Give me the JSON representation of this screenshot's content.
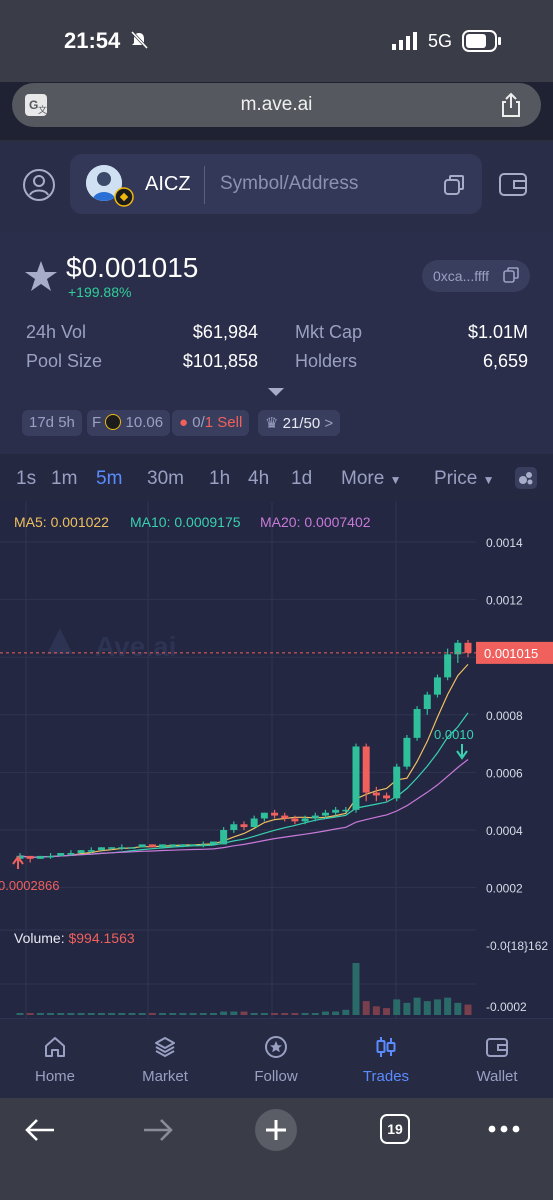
{
  "status_bar": {
    "time": "21:54",
    "network": "5G"
  },
  "browser": {
    "url": "m.ave.ai",
    "tabs_count": "19"
  },
  "header": {
    "token_symbol": "AICZ",
    "search_placeholder": "Symbol/Address"
  },
  "token": {
    "price": "$0.001015",
    "change": "+199.88%",
    "address": "0xca...ffff"
  },
  "stats": {
    "vol_label": "24h Vol",
    "vol_value": "$61,984",
    "pool_label": "Pool Size",
    "pool_value": "$101,858",
    "mcap_label": "Mkt Cap",
    "mcap_value": "$1.01M",
    "holders_label": "Holders",
    "holders_value": "6,659"
  },
  "chips": {
    "age": "17d 5h",
    "f_prefix": "F",
    "f_value": "10.06",
    "sell_zero": "0/",
    "sell_label": "1 Sell",
    "holders_ratio": "21/50",
    "chevron": ">"
  },
  "timeframes": [
    "1s",
    "1m",
    "5m",
    "30m",
    "1h",
    "4h",
    "1d"
  ],
  "active_timeframe": "5m",
  "more_label": "More",
  "price_label": "Price",
  "chart_data": {
    "type": "candlestick",
    "ma": {
      "ma5_label": "MA5: 0.001022",
      "ma10_label": "MA10: 0.0009175",
      "ma20_label": "MA20: 0.0007402"
    },
    "y_ticks": [
      "0.0014",
      "0.0012",
      "0.0010",
      "0.0008",
      "0.0006",
      "0.0004",
      "0.0002",
      "-0.0{18}162",
      "-0.0002"
    ],
    "current_price_label": "0.001015",
    "high_marker": "0.0010",
    "low_marker": "0.0002866",
    "watermark": "Ave.ai",
    "volume_label": "Volume:",
    "volume_value": "$994.1563",
    "ylim": [
      0.00015,
      0.0014
    ],
    "candles": [
      [
        0.0003,
        0.00031,
        0.00032,
        0.00029
      ],
      [
        0.00031,
        0.0003,
        0.00031,
        0.000287
      ],
      [
        0.0003,
        0.00031,
        0.00031,
        0.0003
      ],
      [
        0.00031,
        0.00031,
        0.00032,
        0.0003
      ],
      [
        0.00031,
        0.00032,
        0.00032,
        0.00031
      ],
      [
        0.00032,
        0.00032,
        0.00033,
        0.00031
      ],
      [
        0.00032,
        0.00033,
        0.00033,
        0.00032
      ],
      [
        0.00033,
        0.00033,
        0.00034,
        0.00032
      ],
      [
        0.00033,
        0.00034,
        0.00034,
        0.00033
      ],
      [
        0.00034,
        0.00034,
        0.00034,
        0.00033
      ],
      [
        0.00034,
        0.00034,
        0.00035,
        0.00033
      ],
      [
        0.00034,
        0.00034,
        0.00034,
        0.00034
      ],
      [
        0.00034,
        0.00035,
        0.00035,
        0.00034
      ],
      [
        0.00035,
        0.00034,
        0.00035,
        0.00034
      ],
      [
        0.00034,
        0.00035,
        0.00035,
        0.00034
      ],
      [
        0.00035,
        0.00035,
        0.00035,
        0.00034
      ],
      [
        0.00035,
        0.00035,
        0.00035,
        0.00034
      ],
      [
        0.00035,
        0.00035,
        0.00035,
        0.00035
      ],
      [
        0.00035,
        0.00035,
        0.00036,
        0.00034
      ],
      [
        0.00035,
        0.00036,
        0.00036,
        0.00035
      ],
      [
        0.00035,
        0.0004,
        0.00041,
        0.00035
      ],
      [
        0.0004,
        0.00042,
        0.00043,
        0.00039
      ],
      [
        0.00042,
        0.00041,
        0.00043,
        0.0004
      ],
      [
        0.00041,
        0.00044,
        0.00045,
        0.00041
      ],
      [
        0.00044,
        0.00046,
        0.00046,
        0.00043
      ],
      [
        0.00046,
        0.00045,
        0.00047,
        0.00044
      ],
      [
        0.00045,
        0.00044,
        0.00046,
        0.00043
      ],
      [
        0.00044,
        0.00043,
        0.00045,
        0.00042
      ],
      [
        0.00043,
        0.00044,
        0.00045,
        0.00042
      ],
      [
        0.00044,
        0.00045,
        0.00046,
        0.00043
      ],
      [
        0.00045,
        0.00046,
        0.00047,
        0.00044
      ],
      [
        0.00046,
        0.00047,
        0.00048,
        0.00045
      ],
      [
        0.00047,
        0.00047,
        0.00048,
        0.00046
      ],
      [
        0.00047,
        0.00069,
        0.0007,
        0.00046
      ],
      [
        0.00069,
        0.00053,
        0.0007,
        0.0005
      ],
      [
        0.00053,
        0.00052,
        0.00055,
        0.0005
      ],
      [
        0.00052,
        0.00051,
        0.00053,
        0.0005
      ],
      [
        0.00051,
        0.00062,
        0.00063,
        0.0005
      ],
      [
        0.00062,
        0.00072,
        0.00073,
        0.00061
      ],
      [
        0.00072,
        0.00082,
        0.00083,
        0.00071
      ],
      [
        0.00082,
        0.00087,
        0.00088,
        0.0008
      ],
      [
        0.00087,
        0.00093,
        0.00094,
        0.00086
      ],
      [
        0.00093,
        0.00101,
        0.00103,
        0.00092
      ],
      [
        0.00101,
        0.00105,
        0.00106,
        0.00098
      ],
      [
        0.00105,
        0.001015,
        0.00106,
        0.001
      ]
    ],
    "volumes": [
      1,
      1,
      1,
      1,
      1,
      1,
      1,
      1,
      1,
      1,
      1,
      1,
      1,
      1,
      1,
      1,
      1,
      1,
      1,
      1,
      2,
      2,
      2,
      1,
      1,
      1,
      1,
      1,
      1,
      1,
      2,
      2,
      3,
      30,
      8,
      5,
      4,
      9,
      7,
      10,
      8,
      9,
      10,
      7,
      6
    ]
  },
  "tabs": [
    {
      "label": "Home",
      "icon": "home-icon"
    },
    {
      "label": "Market",
      "icon": "layers-icon"
    },
    {
      "label": "Follow",
      "icon": "star-circle-icon"
    },
    {
      "label": "Trades",
      "icon": "candles-icon"
    },
    {
      "label": "Wallet",
      "icon": "wallet-icon"
    }
  ],
  "active_tab": "Trades",
  "colors": {
    "up": "#2fbf9b",
    "down": "#f0605d",
    "accent": "#5b8cff",
    "ma5": "#f0c060",
    "ma10": "#39d0b0",
    "ma20": "#c77ad8"
  }
}
